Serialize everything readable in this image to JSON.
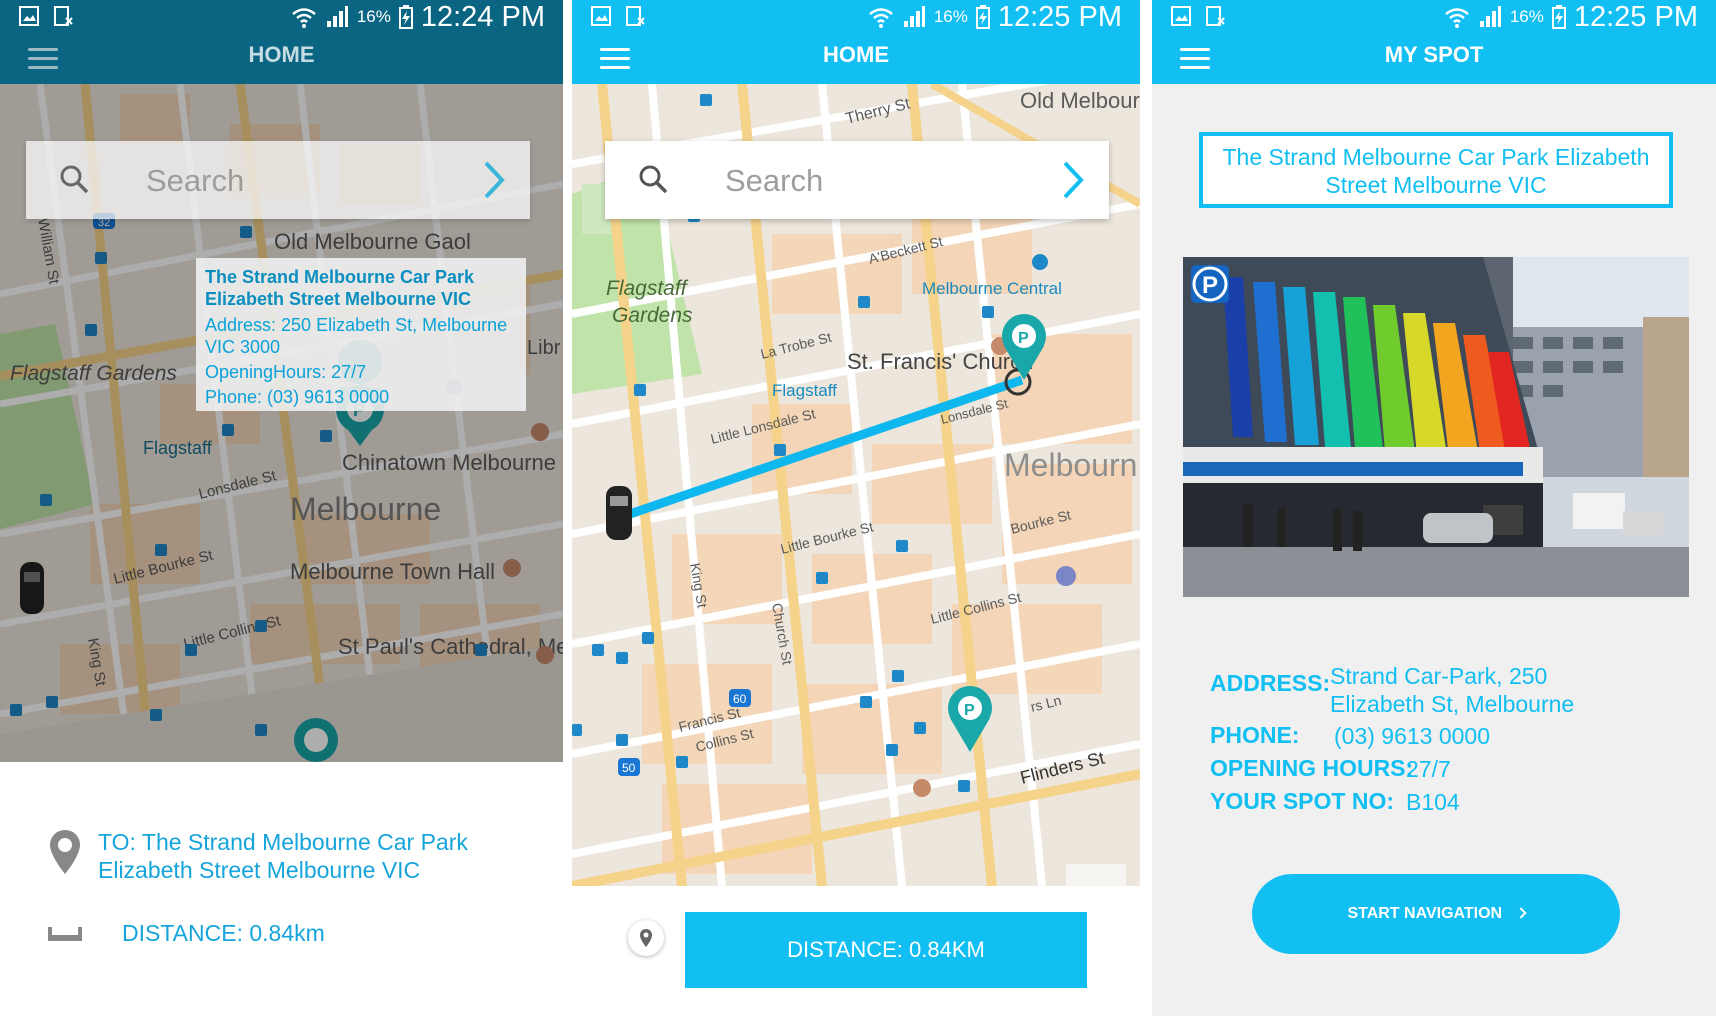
{
  "status": {
    "screen1": {
      "battery": "16%",
      "time": "12:24 PM"
    },
    "screen2": {
      "battery": "16%",
      "time": "12:25 PM"
    },
    "screen3": {
      "battery": "16%",
      "time": "12:25 PM"
    }
  },
  "screen1": {
    "title": "HOME",
    "search_placeholder": "Search",
    "map_labels": {
      "gaol": "Old Melbourne Gaol",
      "flagstaff_gardens": "Flagstaff Gardens",
      "flagstaff": "Flagstaff",
      "chinatown": "Chinatown Melbourne",
      "melbourne": "Melbourne",
      "town_hall": "Melbourne Town Hall",
      "st_pauls": "St Paul's Cathedral, Melbourne",
      "lonsdale": "Lonsdale St",
      "little_bourke": "Little Bourke St",
      "little_collins": "Little Collins St",
      "king": "King St",
      "william": "William St",
      "libr": "Libr",
      "route_32": "32"
    },
    "info_card": {
      "name": "The Strand Melbourne Car Park Elizabeth Street Melbourne VIC",
      "address": "Address: 250 Elizabeth St, Melbourne VIC 3000",
      "hours": "OpeningHours: 27/7",
      "phone": "Phone: (03) 9613 0000"
    },
    "destination": "TO: The Strand Melbourne Car Park Elizabeth Street Melbourne VIC",
    "distance": "DISTANCE: 0.84km"
  },
  "screen2": {
    "title": "HOME",
    "search_placeholder": "Search",
    "map_labels": {
      "old_melbourne": "Old Melbourn",
      "therry": "Therry St",
      "flagstaff_gardens": "Flagstaff Gardens",
      "abeckett": "A'Beckett St",
      "melbourne_central": "Melbourne Central",
      "la_trobe": "La Trobe St",
      "st_francis": "St. Francis' Church",
      "flagstaff": "Flagstaff",
      "little_lonsdale": "Little Lonsdale St",
      "lonsdale": "Lonsdale St",
      "melbourne": "Melbourn",
      "bourke": "Bourke St",
      "little_bourke": "Little Bourke St",
      "little_collins": "Little Collins St",
      "king": "King St",
      "church": "Church St",
      "francis": "Francis St",
      "collins": "Collins St",
      "flinders": "Flinders St",
      "flinders_ln": "rs Ln",
      "route_60": "60",
      "route_50": "50"
    },
    "distance_button": "DISTANCE: 0.84KM"
  },
  "screen3": {
    "title": "MY SPOT",
    "spot_name": "The Strand Melbourne Car Park Elizabeth Street Melbourne VIC",
    "photo_sign": "P",
    "details": {
      "address_label": "ADDRESS:",
      "address_value": "Strand Car-Park, 250 Elizabeth St, Melbourne",
      "phone_label": "PHONE:",
      "phone_value": "(03) 9613 0000",
      "hours_label": "OPENING HOURS:",
      "hours_value": "27/7",
      "spot_label": "YOUR SPOT NO:",
      "spot_value": "B104"
    },
    "start_button": "START NAVIGATION"
  },
  "colors": {
    "accent": "#11bff3",
    "dark_bar": "#0a6582",
    "route": "#0fb7ef"
  }
}
